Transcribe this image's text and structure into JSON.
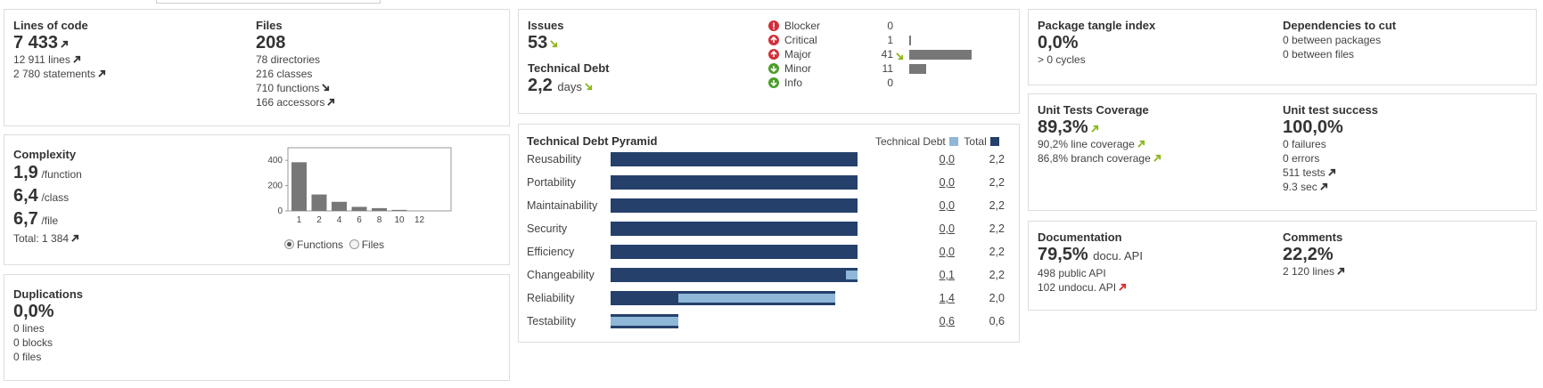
{
  "size": {
    "loc_title": "Lines of code",
    "loc_value": "7 433",
    "loc_lines": "12 911 lines",
    "loc_statements": "2 780 statements",
    "files_title": "Files",
    "files_value": "208",
    "directories": "78 directories",
    "classes": "216 classes",
    "functions": "710 functions",
    "accessors": "166 accessors"
  },
  "complexity": {
    "title": "Complexity",
    "per_function": "1,9",
    "per_function_unit": "/function",
    "per_class": "6,4",
    "per_class_unit": "/class",
    "per_file": "6,7",
    "per_file_unit": "/file",
    "total": "Total: 1 384",
    "chart_data": {
      "type": "bar",
      "categories": [
        "1",
        "2",
        "4",
        "6",
        "8",
        "10",
        "12"
      ],
      "values": [
        385,
        130,
        72,
        32,
        22,
        8,
        0
      ],
      "yticks": [
        "0",
        "200",
        "400"
      ],
      "ylim": [
        0,
        500
      ]
    },
    "radio_functions": "Functions",
    "radio_files": "Files"
  },
  "duplications": {
    "title": "Duplications",
    "value": "0,0%",
    "lines": "0 lines",
    "blocks": "0 blocks",
    "files": "0 files"
  },
  "issues": {
    "title": "Issues",
    "value": "53",
    "debt_title": "Technical Debt",
    "debt_value": "2,2",
    "debt_unit": "days",
    "severities": [
      {
        "label": "Blocker",
        "count": "0",
        "color": "#d02f3a",
        "icon": "blocker-icon",
        "fraction": 0
      },
      {
        "label": "Critical",
        "count": "1",
        "color": "#d02f3a",
        "icon": "critical-icon",
        "fraction": 0.024
      },
      {
        "label": "Major",
        "count": "41",
        "color": "#d02f3a",
        "icon": "major-icon",
        "fraction": 1
      },
      {
        "label": "Minor",
        "count": "11",
        "color": "#4b9d2a",
        "icon": "minor-icon",
        "fraction": 0.268
      },
      {
        "label": "Info",
        "count": "0",
        "color": "#4b9d2a",
        "icon": "info-icon",
        "fraction": 0
      }
    ]
  },
  "pyramid": {
    "title": "Technical Debt Pyramid",
    "legend_debt": "Technical Debt",
    "legend_total": "Total",
    "color_debt": "#8fb7d7",
    "color_total": "#25406b",
    "rows": [
      {
        "label": "Reusability",
        "debt": "0,0",
        "total": "2,2",
        "debt_v": 0.0,
        "total_v": 2.2,
        "start_v": 0.0
      },
      {
        "label": "Portability",
        "debt": "0,0",
        "total": "2,2",
        "debt_v": 0.0,
        "total_v": 2.2,
        "start_v": 0.0
      },
      {
        "label": "Maintainability",
        "debt": "0,0",
        "total": "2,2",
        "debt_v": 0.0,
        "total_v": 2.2,
        "start_v": 0.0
      },
      {
        "label": "Security",
        "debt": "0,0",
        "total": "2,2",
        "debt_v": 0.0,
        "total_v": 2.2,
        "start_v": 0.0
      },
      {
        "label": "Efficiency",
        "debt": "0,0",
        "total": "2,2",
        "debt_v": 0.0,
        "total_v": 2.2,
        "start_v": 0.0
      },
      {
        "label": "Changeability",
        "debt": "0,1",
        "total": "2,2",
        "debt_v": 0.1,
        "total_v": 2.2,
        "start_v": 2.1
      },
      {
        "label": "Reliability",
        "debt": "1,4",
        "total": "2,0",
        "debt_v": 1.4,
        "total_v": 2.0,
        "start_v": 0.6
      },
      {
        "label": "Testability",
        "debt": "0,6",
        "total": "0,6",
        "debt_v": 0.6,
        "total_v": 0.6,
        "start_v": 0.0
      }
    ]
  },
  "design": {
    "tangle_title": "Package tangle index",
    "tangle_value": "0,0%",
    "cycles": "> 0 cycles",
    "deps_title": "Dependencies to cut",
    "between_packages": "0 between packages",
    "between_files": "0 between files"
  },
  "tests": {
    "coverage_title": "Unit Tests Coverage",
    "coverage_value": "89,3%",
    "line_coverage": "90,2% line coverage",
    "branch_coverage": "86,8% branch coverage",
    "success_title": "Unit test success",
    "success_value": "100,0%",
    "failures": "0 failures",
    "errors": "0 errors",
    "tests": "511 tests",
    "duration": "9.3 sec"
  },
  "documentation": {
    "doc_title": "Documentation",
    "doc_value": "79,5%",
    "doc_unit": "docu. API",
    "public_api": "498 public API",
    "undocu_api": "102 undocu. API",
    "comments_title": "Comments",
    "comments_value": "22,2%",
    "comment_lines": "2 120 lines"
  },
  "colors": {
    "trend_dark": "#333333",
    "trend_green": "#8cb61a",
    "trend_red": "#d92b2b"
  }
}
